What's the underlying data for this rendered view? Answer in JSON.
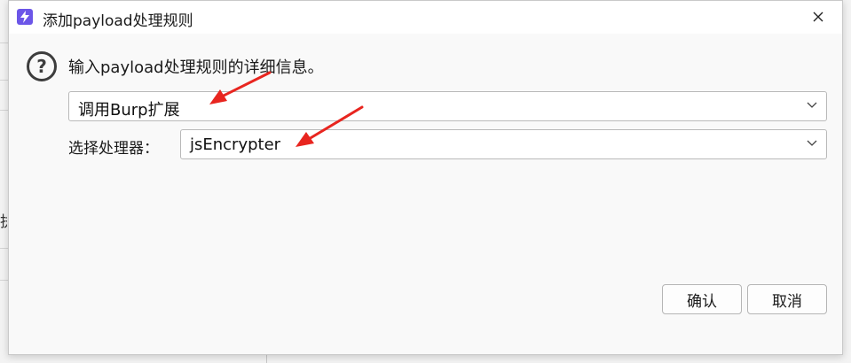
{
  "dialog": {
    "title": "添加payload处理规则",
    "message": "输入payload处理规则的详细信息。",
    "rule_type": {
      "value": "调用Burp扩展"
    },
    "processor": {
      "label": "选择处理器：",
      "value": "jsEncrypter"
    },
    "buttons": {
      "ok": "确认",
      "cancel": "取消"
    }
  },
  "background": {
    "partial_glyph": "执"
  },
  "icons": {
    "app": "lightning-icon",
    "close": "close-icon",
    "help": "question-circle-icon",
    "dropdown": "chevron-down-icon"
  },
  "colors": {
    "accent": "#6c56e8",
    "annotation_arrow": "#e8251f"
  }
}
